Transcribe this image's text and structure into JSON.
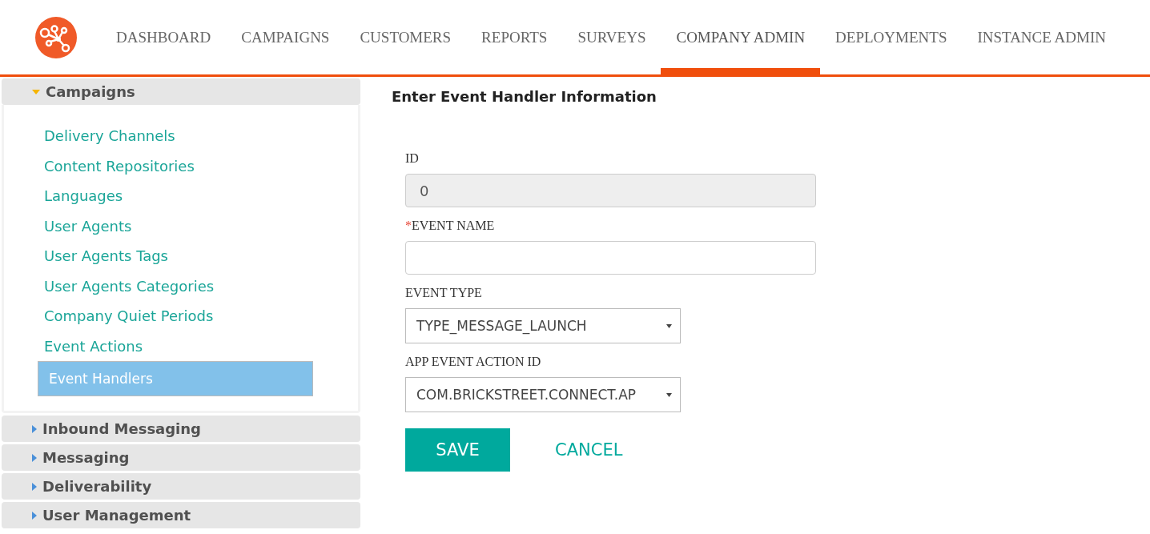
{
  "nav": {
    "items": [
      {
        "label": "DASHBOARD",
        "selected": false
      },
      {
        "label": "CAMPAIGNS",
        "selected": false
      },
      {
        "label": "CUSTOMERS",
        "selected": false
      },
      {
        "label": "REPORTS",
        "selected": false
      },
      {
        "label": "SURVEYS",
        "selected": false
      },
      {
        "label": "COMPANY ADMIN",
        "selected": true
      },
      {
        "label": "DEPLOYMENTS",
        "selected": false
      },
      {
        "label": "INSTANCE ADMIN",
        "selected": false
      }
    ]
  },
  "sidebar": {
    "sections": [
      {
        "title": "Campaigns",
        "expanded": true,
        "items": [
          {
            "label": "Delivery Channels",
            "selected": false
          },
          {
            "label": "Content Repositories",
            "selected": false
          },
          {
            "label": "Languages",
            "selected": false
          },
          {
            "label": "User Agents",
            "selected": false
          },
          {
            "label": "User Agents Tags",
            "selected": false
          },
          {
            "label": "User Agents Categories",
            "selected": false
          },
          {
            "label": "Company Quiet Periods",
            "selected": false
          },
          {
            "label": "Event Actions",
            "selected": false
          },
          {
            "label": "Event Handlers",
            "selected": true
          }
        ]
      },
      {
        "title": "Inbound Messaging",
        "expanded": false
      },
      {
        "title": "Messaging",
        "expanded": false
      },
      {
        "title": "Deliverability",
        "expanded": false
      },
      {
        "title": "User Management",
        "expanded": false
      }
    ]
  },
  "form": {
    "title": "Enter Event Handler Information",
    "fields": [
      {
        "kind": "readonly",
        "label": "ID",
        "required": false,
        "value": "0"
      },
      {
        "kind": "text",
        "label": "EVENT NAME",
        "required": true
      },
      {
        "kind": "select",
        "label": "EVENT TYPE",
        "required": false,
        "value": "TYPE_MESSAGE_LAUNCH"
      },
      {
        "kind": "select",
        "label": "APP EVENT ACTION ID",
        "required": false,
        "value": "COM.BRICKSTREET.CONNECT.AP"
      }
    ],
    "required_mark": "*",
    "save": "SAVE",
    "cancel": "CANCEL"
  }
}
